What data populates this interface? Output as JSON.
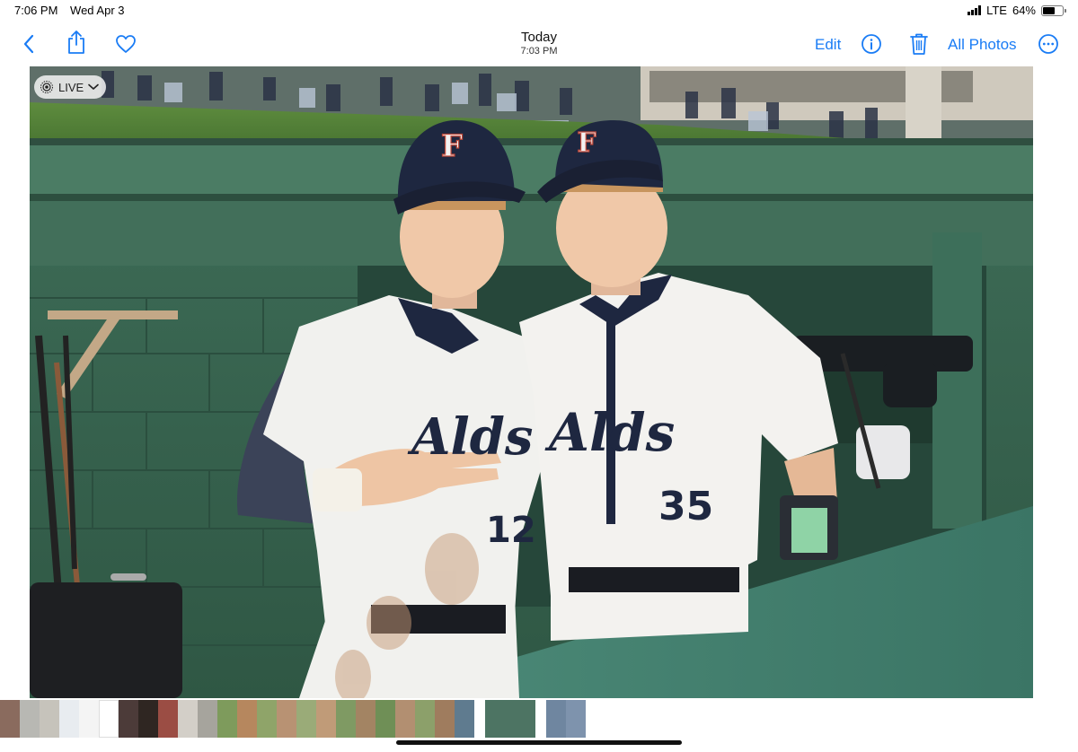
{
  "status": {
    "time": "7:06 PM",
    "date": "Wed Apr 3",
    "network": "LTE",
    "battery": "64%",
    "battery_level": 0.64
  },
  "toolbar": {
    "title": "Today",
    "subtitle": "7:03 PM",
    "edit_label": "Edit",
    "all_photos_label": "All Photos",
    "icons": [
      "chevron-left-icon",
      "share-icon",
      "heart-icon",
      "info-icon",
      "trash-icon",
      "more-icon"
    ]
  },
  "photo": {
    "live_label": "LIVE",
    "cap_letter": "F",
    "jersey_script": "Alds",
    "jersey_number_left": "12",
    "jersey_number_right": "35"
  },
  "colors": {
    "accent": "#1a7cf5",
    "dugout_green": "#3f6e58",
    "navy": "#1e2740",
    "jersey_white": "#f1f1ee"
  }
}
